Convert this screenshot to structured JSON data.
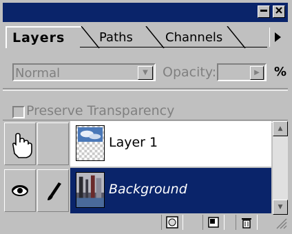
{
  "window": {
    "minimize_icon": "minimize-icon",
    "close_icon": "close-icon",
    "title_bg": "#0a246a"
  },
  "tabs": [
    {
      "label": "Layers",
      "active": true
    },
    {
      "label": "Paths",
      "active": false
    },
    {
      "label": "Channels",
      "active": false
    }
  ],
  "controls": {
    "blend_mode": "Normal",
    "opacity_label": "Opacity:",
    "opacity_value": "",
    "percent_sign": "%",
    "preserve_transparency_label": "Preserve Transparency",
    "preserve_transparency_checked": false
  },
  "layers": [
    {
      "name": "Layer 1",
      "visible": false,
      "selected": false,
      "cursor": "hand-cursor-icon"
    },
    {
      "name": "Background",
      "visible": true,
      "selected": true,
      "brush": true
    }
  ],
  "colors": {
    "selection": "#0a246a",
    "panel": "#c0c0c0"
  },
  "bottom_toolbar": [
    "layer-mask-icon",
    "new-layer-icon",
    "trash-icon"
  ]
}
